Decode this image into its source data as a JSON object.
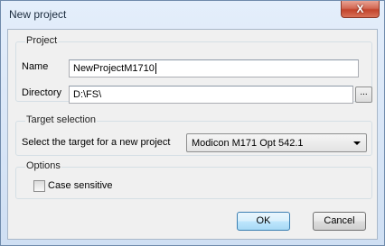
{
  "window": {
    "title": "New project",
    "close_glyph": "X"
  },
  "project_group": {
    "label": "Project",
    "name_label": "Name",
    "name_value": "NewProjectM1710",
    "directory_label": "Directory",
    "directory_value": "D:\\FS\\",
    "browse_label": "..."
  },
  "target_group": {
    "label": "Target selection",
    "prompt": "Select the target for a new project",
    "selected_target": "Modicon M171 Opt 542.1"
  },
  "options_group": {
    "label": "Options",
    "case_sensitive_label": "Case sensitive",
    "case_sensitive_checked": false
  },
  "buttons": {
    "ok_label": "OK",
    "cancel_label": "Cancel"
  }
}
